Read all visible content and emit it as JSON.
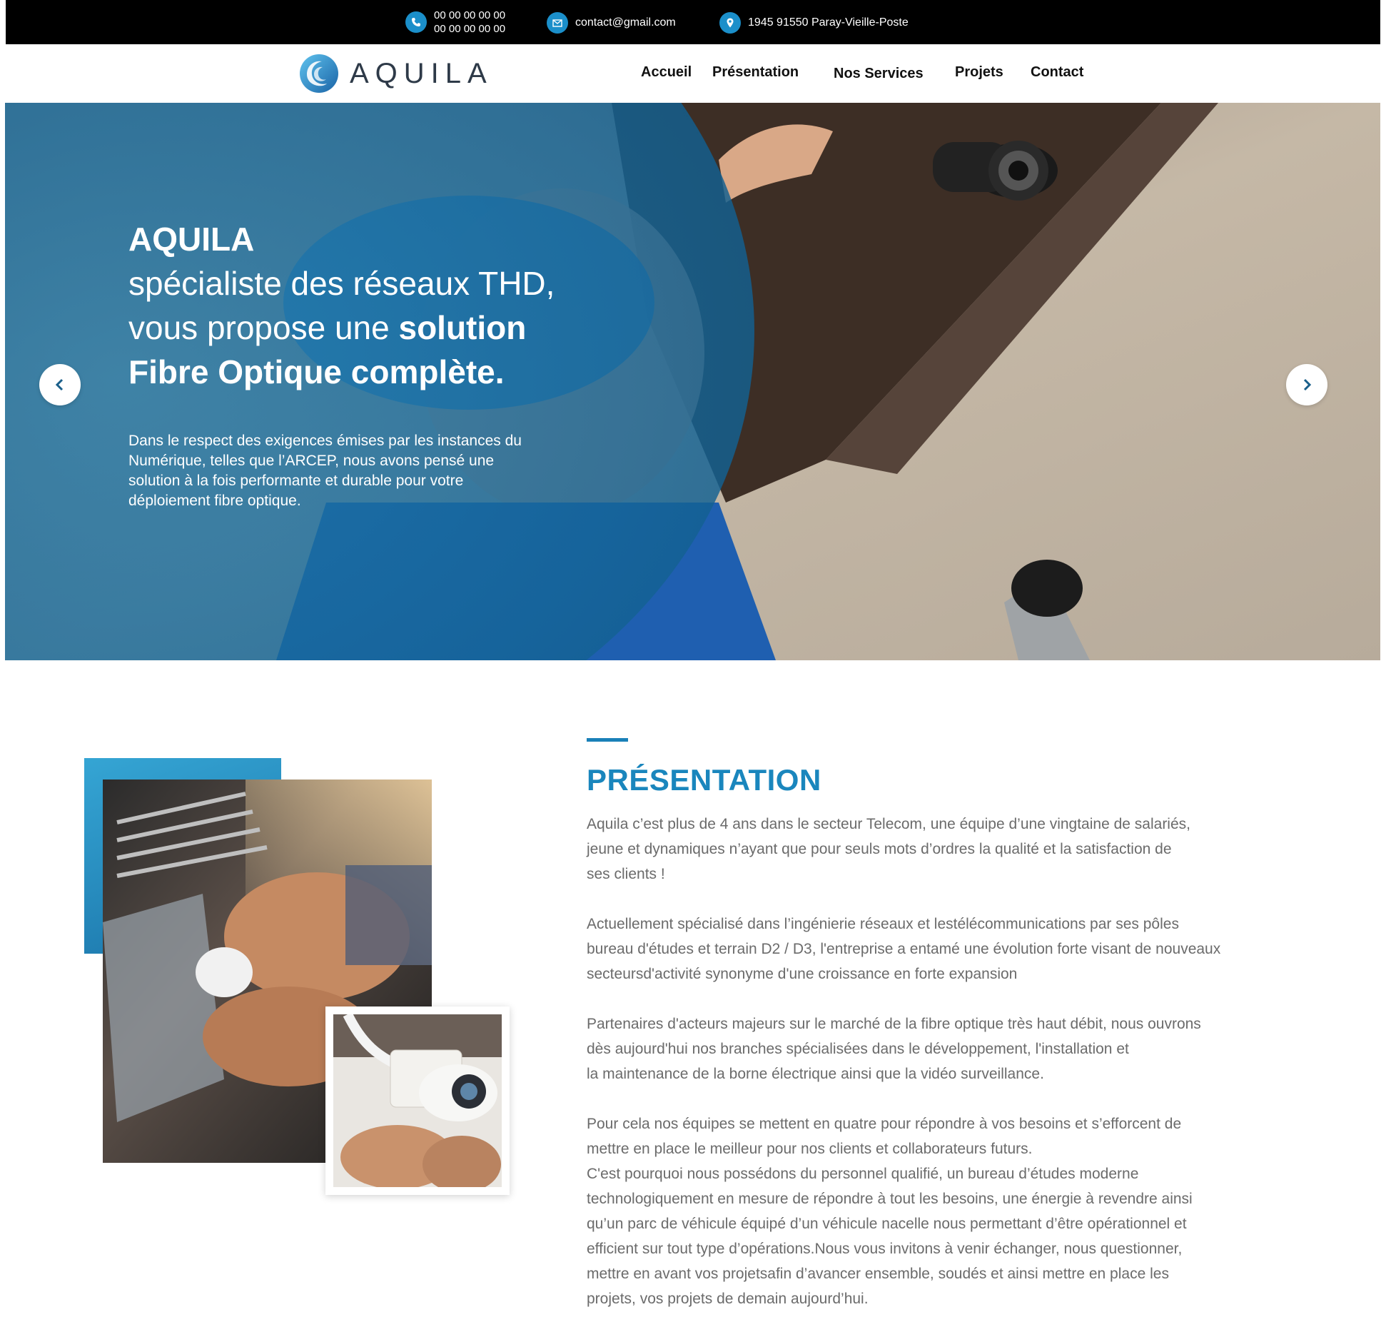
{
  "topbar": {
    "phone_1": "00 00 00 00 00",
    "phone_2": "00 00 00 00 00",
    "email": "contact@gmail.com",
    "address": "1945 91550 Paray-Vieille-Poste",
    "icons": [
      "phone-icon",
      "mail-icon",
      "location-icon"
    ]
  },
  "header": {
    "logo_text": "AQUILA",
    "nav": [
      "Accueil",
      "Présentation",
      "Nos Services",
      "Projets",
      "Contact"
    ]
  },
  "hero": {
    "brand": "AQUILA",
    "line_1": "spécialiste des réseaux THD,",
    "line_2_prefix": "vous propose une ",
    "line_2_bold": "solution",
    "line_3": "Fibre Optique complète.",
    "description": "Dans le respect des exigences émises par les instances du Numérique, telles que l’ARCEP, nous avons pensé une solution à la fois performante et durable pour votre déploiement fibre optique.",
    "prev_icon": "chevron-left-icon",
    "next_icon": "chevron-right-icon"
  },
  "presentation": {
    "title": "PRÉSENTATION",
    "p1": "Aquila c’est plus de 4 ans dans le secteur Telecom, une équipe d’une vingtaine de salariés,\n jeune et dynamiques n’ayant que pour seuls mots d’ordres la qualité et la satisfaction de\nses clients !",
    "p2": "Actuellement spécialisé dans l’ingénierie réseaux et lestélécommunications par ses pôles\nbureau d'études et terrain D2 / D3, l'entreprise a entamé une évolution forte visant de nouveaux\nsecteursd'activité synonyme d'une croissance en forte expansion",
    "p3": "Partenaires d'acteurs majeurs sur le marché de la fibre optique très haut débit, nous ouvrons\ndès aujourd'hui nos branches spécialisées dans le développement, l'installation et\nla maintenance de la borne électrique ainsi que la vidéo surveillance.",
    "p4": "Pour cela nos équipes se mettent en quatre pour répondre à vos besoins et s’efforcent de\nmettre  en place le meilleur pour nos clients et collaborateurs futurs.",
    "p5": "C'est pourquoi nous possédons du personnel qualifié, un bureau d’études moderne\ntechnologiquement en mesure de répondre à tout les besoins,  une énergie à revendre ainsi\nqu’un parc de véhicule équipé d’un véhicule nacelle nous permettant d’être opérationnel et\nefficient sur tout type d’opérations.Nous vous invitons à venir échanger, nous questionner,\nmettre en avant vos projetsafin d’avancer ensemble, soudés et ainsi mettre en place les\nprojets, vos projets de demain aujourd’hui."
  },
  "colors": {
    "accent": "#1a86bd",
    "topbar": "#000000",
    "body_text": "#6b6b6b"
  }
}
